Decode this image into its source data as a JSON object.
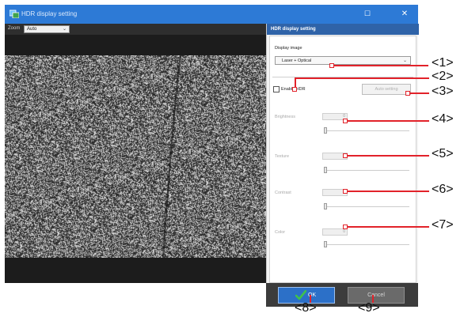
{
  "window": {
    "title": "HDR display setting",
    "max_icon": "maximize-icon",
    "close_icon": "close-icon",
    "accent": "#2d7ad6"
  },
  "zoom": {
    "label": "Zoom",
    "value": "Auto"
  },
  "panel": {
    "header": "HDR display setting",
    "display_image": {
      "label": "Display image",
      "value": "Laser + Optical"
    },
    "enable_hdr": {
      "label": "Enable HDR",
      "checked": false
    },
    "auto_setting": "Auto setting",
    "sliders": [
      {
        "label": "Brightness",
        "value": "0"
      },
      {
        "label": "Texture",
        "value": "0"
      },
      {
        "label": "Contrast",
        "value": "0"
      },
      {
        "label": "Color",
        "value": "0"
      }
    ]
  },
  "buttons": {
    "ok": "OK",
    "cancel": "Cancel",
    "ok_color": "#2c70c8"
  },
  "callouts": [
    "<1>",
    "<2>",
    "<3>",
    "<4>",
    "<5>",
    "<6>",
    "<7>",
    "<8>",
    "<9>"
  ]
}
